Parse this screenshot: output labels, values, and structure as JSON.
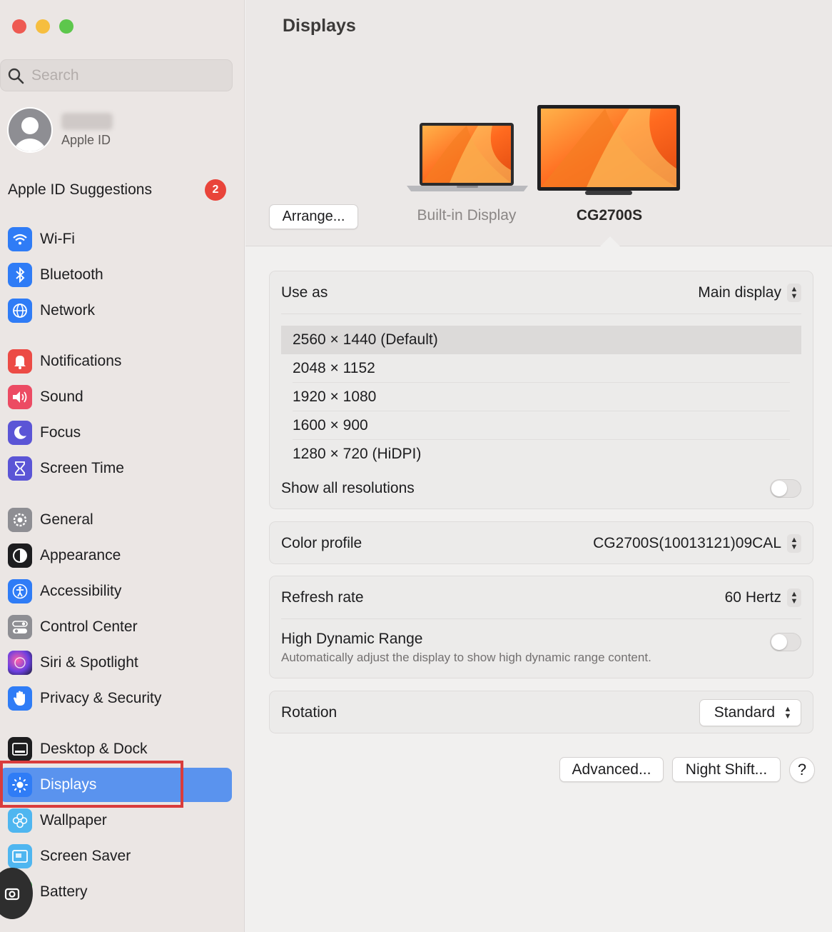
{
  "window": {
    "title": "Displays"
  },
  "sidebar": {
    "search_placeholder": "Search",
    "profile": {
      "subtitle": "Apple ID"
    },
    "suggestions": {
      "label": "Apple ID Suggestions",
      "badge": "2"
    },
    "items": [
      {
        "label": "Wi-Fi",
        "icon": "wifi-icon",
        "color": "#2f7cf6"
      },
      {
        "label": "Bluetooth",
        "icon": "bluetooth-icon",
        "color": "#2f7cf6"
      },
      {
        "label": "Network",
        "icon": "globe-icon",
        "color": "#2f7cf6"
      },
      {
        "label": "Notifications",
        "icon": "bell-icon",
        "color": "#ec4b45"
      },
      {
        "label": "Sound",
        "icon": "speaker-icon",
        "color": "#ec4b63"
      },
      {
        "label": "Focus",
        "icon": "moon-icon",
        "color": "#5b55d6"
      },
      {
        "label": "Screen Time",
        "icon": "hourglass-icon",
        "color": "#5b55d6"
      },
      {
        "label": "General",
        "icon": "gear-icon",
        "color": "#8e8e93"
      },
      {
        "label": "Appearance",
        "icon": "appearance-icon",
        "color": "#1d1d1f"
      },
      {
        "label": "Accessibility",
        "icon": "accessibility-icon",
        "color": "#2f7cf6"
      },
      {
        "label": "Control Center",
        "icon": "control-center-icon",
        "color": "#8e8e93"
      },
      {
        "label": "Siri & Spotlight",
        "icon": "siri-icon",
        "color": "#8d3fd6"
      },
      {
        "label": "Privacy & Security",
        "icon": "hand-icon",
        "color": "#2f7cf6"
      },
      {
        "label": "Desktop & Dock",
        "icon": "dock-icon",
        "color": "#1d1d1f"
      },
      {
        "label": "Displays",
        "icon": "sun-icon",
        "color": "#2f7cf6"
      },
      {
        "label": "Wallpaper",
        "icon": "flower-icon",
        "color": "#4fb6f0"
      },
      {
        "label": "Screen Saver",
        "icon": "screensaver-icon",
        "color": "#4fb6f0"
      },
      {
        "label": "Battery",
        "icon": "battery-icon",
        "color": "#39b54a"
      }
    ]
  },
  "main": {
    "title": "Displays",
    "arrange_label": "Arrange...",
    "displays": [
      {
        "label": "Built-in Display"
      },
      {
        "label": "CG2700S"
      }
    ],
    "use_as": {
      "label": "Use as",
      "value": "Main display"
    },
    "resolutions": [
      "2560 × 1440 (Default)",
      "2048 × 1152",
      "1920 × 1080",
      "1600 × 900",
      "1280 × 720 (HiDPI)"
    ],
    "show_all_resolutions": {
      "label": "Show all resolutions"
    },
    "color_profile": {
      "label": "Color profile",
      "value": "CG2700S(10013121)09CAL"
    },
    "refresh_rate": {
      "label": "Refresh rate",
      "value": "60 Hertz"
    },
    "hdr": {
      "label": "High Dynamic Range",
      "description": "Automatically adjust the display to show high dynamic range content."
    },
    "rotation": {
      "label": "Rotation",
      "value": "Standard"
    },
    "buttons": {
      "advanced": "Advanced...",
      "night_shift": "Night Shift...",
      "help": "?"
    }
  },
  "colors": {
    "accent": "#5a93ee",
    "badge": "#e9443a",
    "highlight": "#d93c3c"
  }
}
